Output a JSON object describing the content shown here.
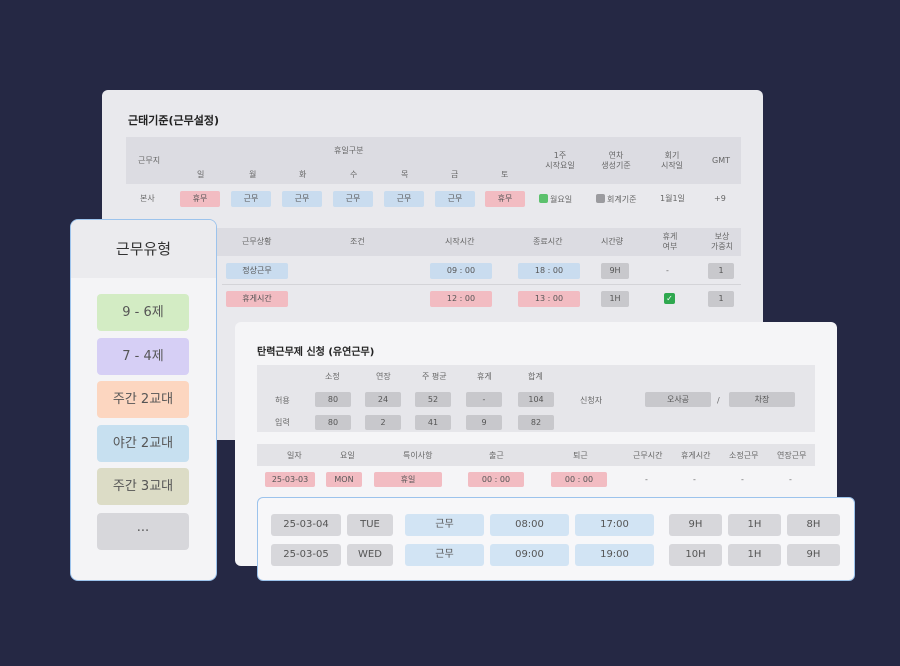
{
  "attendance": {
    "title": "근태기준(근무설정)",
    "headers": {
      "workplace": "근무지",
      "holiday_group": "휴일구분",
      "days": [
        "일",
        "월",
        "화",
        "수",
        "목",
        "금",
        "토"
      ],
      "week_start": [
        "1주",
        "시작요일"
      ],
      "annual_leave": [
        "연차",
        "생성기준"
      ],
      "fiscal": [
        "회기",
        "시작일"
      ],
      "gmt": "GMT"
    },
    "row": {
      "workplace": "본사",
      "days": [
        "휴무",
        "근무",
        "근무",
        "근무",
        "근무",
        "근무",
        "휴무"
      ],
      "week_start": "월요일",
      "annual_leave": "회계기준",
      "fiscal": "1월1일",
      "gmt": "+9"
    },
    "headers2": {
      "status": "근무상황",
      "condition": "조건",
      "start": "시작시간",
      "end": "종료시간",
      "hours": "시간량",
      "break": [
        "휴게",
        "여부"
      ],
      "comp": [
        "보상",
        "가중치"
      ]
    },
    "rows2": [
      {
        "status": "정상근무",
        "start": "09 : 00",
        "end": "18 : 00",
        "hours": "9H",
        "break": "-",
        "comp": "1"
      },
      {
        "status": "휴게시간",
        "start": "12 : 00",
        "end": "13 : 00",
        "hours": "1H",
        "break": "✓",
        "comp": "1"
      }
    ],
    "colors": {
      "green": "#5cc16d",
      "gray": "#9b9b9f"
    }
  },
  "shift_types": {
    "title": "근무유형",
    "items": [
      {
        "label": "9 - 6제",
        "color": "#d3ecc4"
      },
      {
        "label": "7 - 4제",
        "color": "#d6cff5"
      },
      {
        "label": "주간 2교대",
        "color": "#fcd6c0"
      },
      {
        "label": "야간 2교대",
        "color": "#c7e0f0"
      },
      {
        "label": "주간 3교대",
        "color": "#dcdcc6"
      },
      {
        "label": "···",
        "color": "#d7d7db"
      }
    ]
  },
  "flex": {
    "title": "탄력근무제 신청 (유연근무)",
    "summary_headers": [
      "소정",
      "연장",
      "주 평균",
      "휴게",
      "합계"
    ],
    "summary_rows": [
      {
        "label": "허용",
        "values": [
          "80",
          "24",
          "52",
          "-",
          "104"
        ]
      },
      {
        "label": "입력",
        "values": [
          "80",
          "2",
          "41",
          "9",
          "82"
        ]
      }
    ],
    "applicant_label": "신청자",
    "applicant_name": "오사공",
    "separator": "/",
    "applicant_rank": "차장",
    "detail_headers": [
      "일자",
      "요일",
      "특이사항",
      "출근",
      "퇴근",
      "근무시간",
      "휴게시간",
      "소정근무",
      "연장근무"
    ],
    "detail_row": {
      "date": "25-03-03",
      "day": "MON",
      "note": "휴일",
      "in": "00 : 00",
      "out": "00 : 00",
      "rest": [
        "-",
        "-",
        "-",
        "-"
      ]
    }
  },
  "schedule": {
    "rows": [
      {
        "date": "25-03-04",
        "day": "TUE",
        "type": "근무",
        "in": "08:00",
        "out": "17:00",
        "work": "9H",
        "break": "1H",
        "regular": "8H"
      },
      {
        "date": "25-03-05",
        "day": "WED",
        "type": "근무",
        "in": "09:00",
        "out": "19:00",
        "work": "10H",
        "break": "1H",
        "regular": "9H"
      }
    ]
  }
}
